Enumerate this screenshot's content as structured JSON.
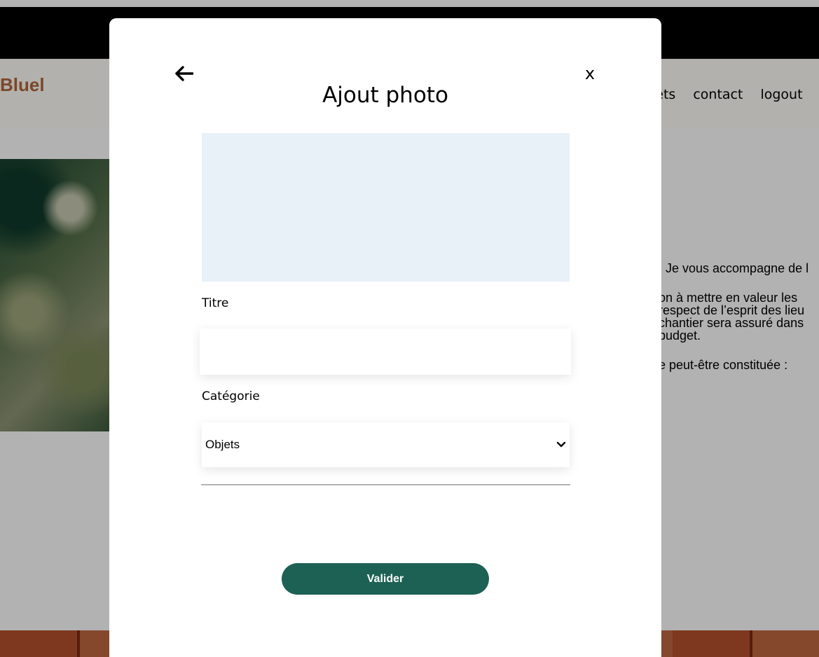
{
  "background_page": {
    "logo_text": "Bluel",
    "nav": [
      {
        "label": "jets"
      },
      {
        "label": "contact"
      },
      {
        "label": "logout"
      }
    ],
    "intro_lines": [
      ". Je vous accompagne de l",
      "on à mettre en valeur les",
      "respect de l’esprit des lieu",
      "chantier sera assuré dans",
      "budget.",
      "e peut-être constituée :"
    ]
  },
  "modal": {
    "title": "Ajout photo",
    "back_icon": "arrow-left-icon",
    "close_label": "x",
    "fields": {
      "title_label": "Titre",
      "title_value": "",
      "category_label": "Catégorie",
      "category_value": "Objets"
    },
    "submit_label": "Valider"
  },
  "colors": {
    "accent": "#1d6154",
    "logo": "#b1663c",
    "dropzone": "#e8f0f8"
  }
}
